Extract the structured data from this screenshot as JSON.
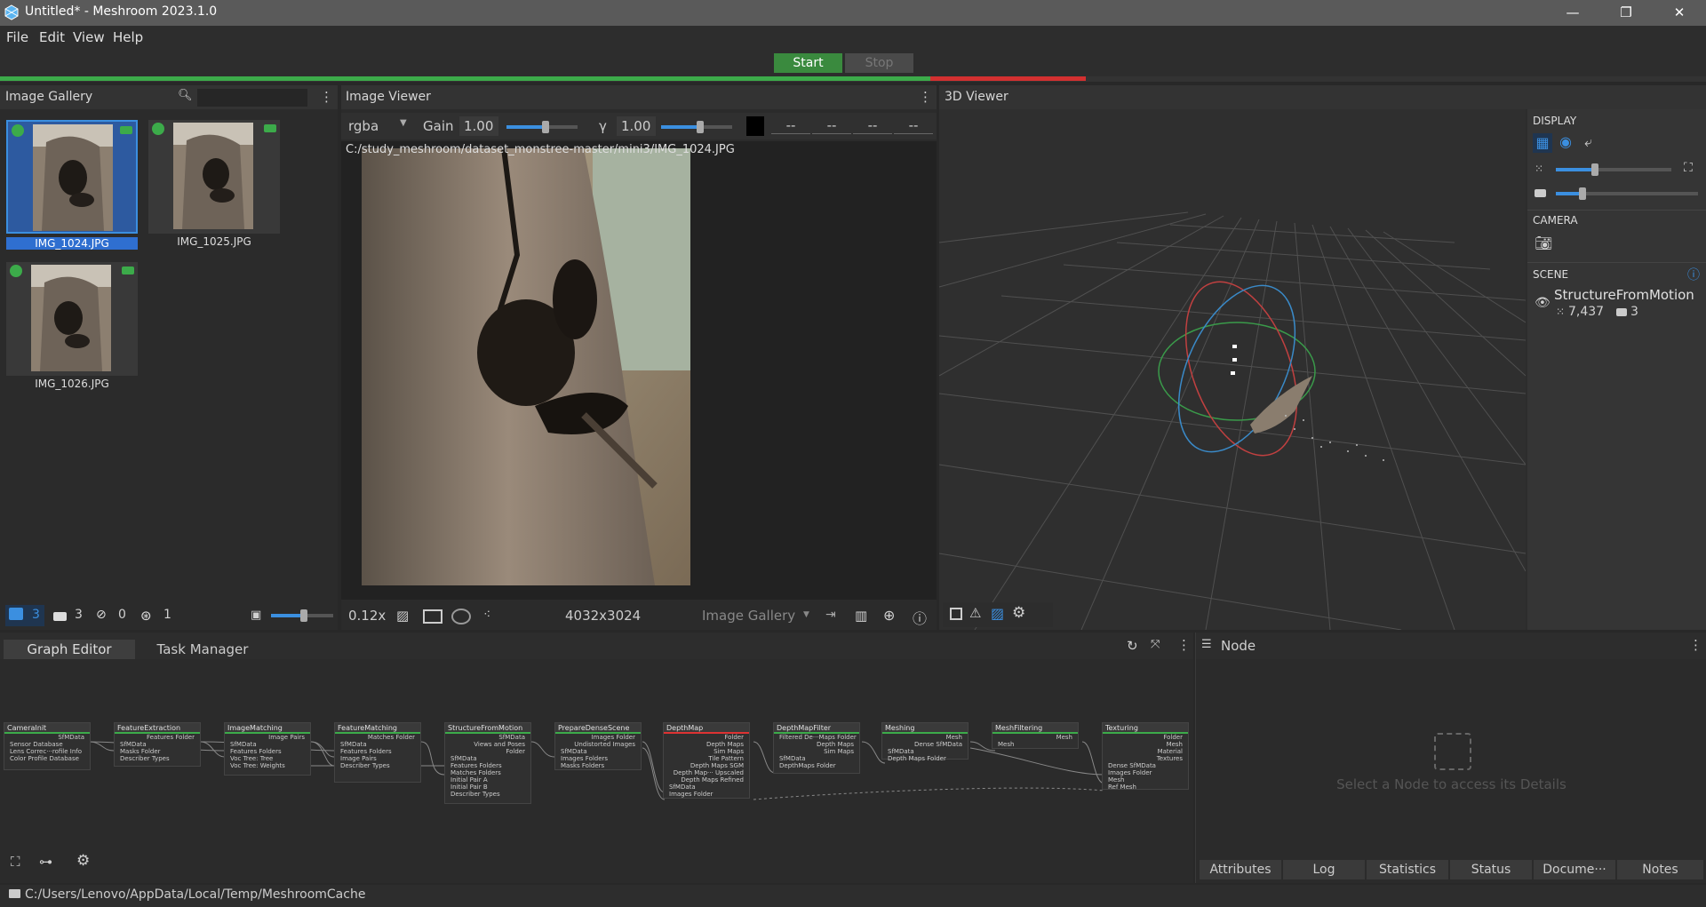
{
  "window": {
    "title": "Untitled* - Meshroom 2023.1.0"
  },
  "menu": [
    "File",
    "Edit",
    "View",
    "Help"
  ],
  "run": {
    "start": "Start",
    "stop": "Stop"
  },
  "gallery": {
    "title": "Image Gallery",
    "search_placeholder": "",
    "images": [
      {
        "name": "IMG_1024.JPG",
        "selected": true
      },
      {
        "name": "IMG_1025.JPG",
        "selected": false
      },
      {
        "name": "IMG_1026.JPG",
        "selected": false
      }
    ],
    "counts": {
      "images": "3",
      "cameras": "3",
      "no_cameras": "0",
      "reconstructed": "1"
    }
  },
  "viewer": {
    "title": "Image Viewer",
    "channel": "rgba",
    "gain_label": "Gain",
    "gain_value": "1.00",
    "gamma_label": "γ",
    "gamma_value": "1.00",
    "pixel_values": [
      "--",
      "--",
      "--",
      "--"
    ],
    "path": "C:/study_meshroom/dataset_monstree-master/mini3/IMG_1024.JPG",
    "zoom": "0.12x",
    "resolution": "4032x3024",
    "source": "Image Gallery"
  },
  "viewer3d": {
    "title": "3D Viewer",
    "display_label": "DISPLAY",
    "camera_label": "CAMERA",
    "scene_label": "SCENE",
    "scene_item": "StructureFromMotion",
    "points": "7,437",
    "cameras": "3"
  },
  "graph": {
    "tabs": [
      "Graph Editor",
      "Task Manager"
    ],
    "nodes": [
      {
        "name": "CameraInit",
        "outs": [
          "SfMData"
        ],
        "ins": [
          "Sensor Database",
          "Lens Correc···rofile Info",
          "Color Profile Database"
        ]
      },
      {
        "name": "FeatureExtraction",
        "outs": [
          "Features Folder"
        ],
        "ins": [
          "SfMData",
          "Masks Folder",
          "Describer Types"
        ]
      },
      {
        "name": "ImageMatching",
        "outs": [
          "Image Pairs"
        ],
        "ins": [
          "SfMData",
          "Features Folders",
          "Voc Tree: Tree",
          "Voc Tree: Weights"
        ]
      },
      {
        "name": "FeatureMatching",
        "outs": [
          "Matches Folder"
        ],
        "ins": [
          "SfMData",
          "Features Folders",
          "Image Pairs",
          "Describer Types"
        ]
      },
      {
        "name": "StructureFromMotion",
        "outs": [
          "SfMData",
          "Views and Poses",
          "Folder"
        ],
        "ins": [
          "SfMData",
          "Features Folders",
          "Matches Folders",
          "Initial Pair A",
          "Initial Pair B",
          "Describer Types"
        ]
      },
      {
        "name": "PrepareDenseScene",
        "outs": [
          "Images Folder",
          "Undistorted Images"
        ],
        "ins": [
          "SfMData",
          "Images Folders",
          "Masks Folders"
        ]
      },
      {
        "name": "DepthMap",
        "outs": [
          "Folder",
          "Depth Maps",
          "Sim Maps",
          "Tile Pattern",
          "Depth Maps SGM",
          "Depth Map··· Upscaled",
          "Depth Maps Refined"
        ],
        "ins": [
          "SfMData",
          "Images Folder"
        ]
      },
      {
        "name": "DepthMapFilter",
        "outs": [
          "Filtered De···Maps Folder",
          "Depth Maps",
          "Sim Maps"
        ],
        "ins": [
          "SfMData",
          "DepthMaps Folder"
        ]
      },
      {
        "name": "Meshing",
        "outs": [
          "Mesh",
          "Dense SfMData"
        ],
        "ins": [
          "SfMData",
          "Depth Maps Folder"
        ]
      },
      {
        "name": "MeshFiltering",
        "outs": [
          "Mesh"
        ],
        "ins": [
          "Mesh"
        ]
      },
      {
        "name": "Texturing",
        "outs": [
          "Folder",
          "Mesh",
          "Material",
          "Textures"
        ],
        "ins": [
          "Dense SfMData",
          "Images Folder",
          "Mesh",
          "Ref Mesh"
        ]
      }
    ]
  },
  "node_panel": {
    "title": "Node",
    "placeholder": "Select a Node to access its Details",
    "tabs": [
      "Attributes",
      "Log",
      "Statistics",
      "Status",
      "Docume···",
      "Notes"
    ]
  },
  "status": {
    "path": "C:/Users/Lenovo/AppData/Local/Temp/MeshroomCache"
  },
  "colors": {
    "accent": "#3b8fe0",
    "green": "#3cab4a",
    "red": "#d33030"
  }
}
